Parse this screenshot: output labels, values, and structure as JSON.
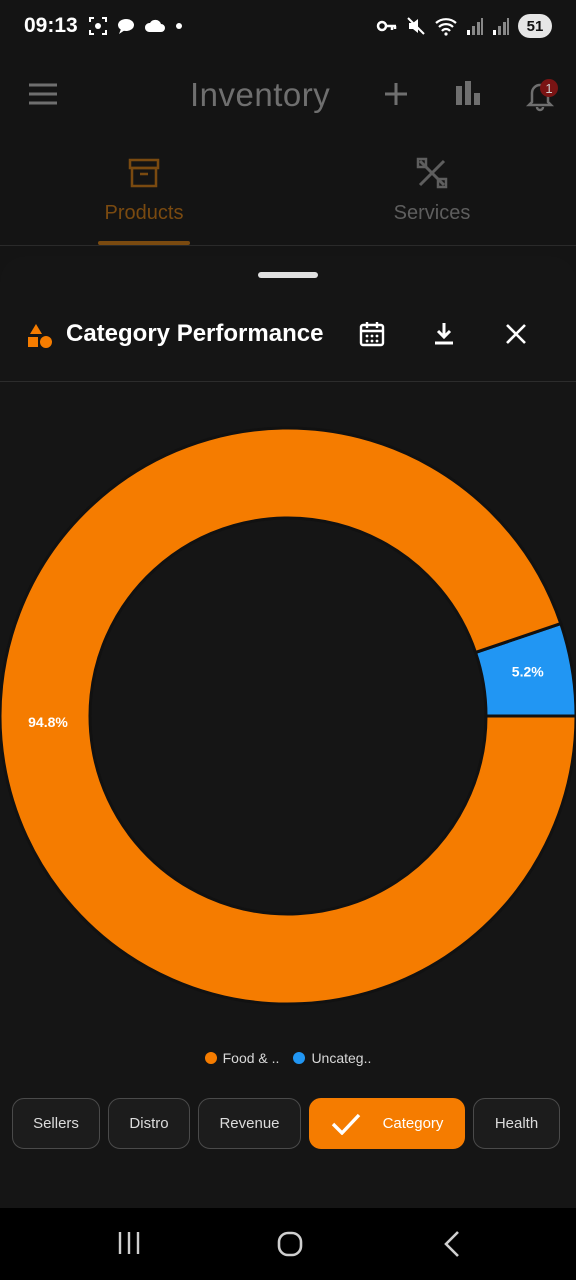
{
  "status_bar": {
    "time": "09:13",
    "battery": "51",
    "left_icons": [
      "screenshot-icon",
      "chat-bubble-icon",
      "cloud-icon",
      "dot-icon"
    ],
    "right_icons": [
      "key-icon",
      "mute-icon",
      "wifi-icon",
      "signal-icon",
      "signal-icon"
    ]
  },
  "app_bar": {
    "title": "Inventory",
    "notification_count": "1",
    "icons": [
      "menu-icon",
      "add-icon",
      "bar-chart-icon",
      "bell-icon"
    ]
  },
  "tabs": [
    {
      "label": "Products",
      "icon": "archive-box-icon",
      "active": true
    },
    {
      "label": "Services",
      "icon": "tools-icon",
      "active": false
    }
  ],
  "sheet": {
    "title": "Category Performance",
    "icons": [
      "category-shapes-icon",
      "calendar-icon",
      "download-icon",
      "close-icon"
    ]
  },
  "chart_data": {
    "type": "pie",
    "variant": "donut",
    "slices": [
      {
        "label": "Food & ..",
        "value": 94.8,
        "display": "94.8%",
        "color": "#f57c00"
      },
      {
        "label": "Uncateg..",
        "value": 5.2,
        "display": "5.2%",
        "color": "#2196f3"
      }
    ],
    "legend_position": "bottom"
  },
  "filters": [
    {
      "label": "Sellers",
      "selected": false
    },
    {
      "label": "Distro",
      "selected": false
    },
    {
      "label": "Revenue",
      "selected": false
    },
    {
      "label": "Category",
      "selected": true
    },
    {
      "label": "Health",
      "selected": false
    }
  ],
  "nav_bar": {
    "icons": [
      "recent-apps-icon",
      "home-icon",
      "back-icon"
    ]
  },
  "colors": {
    "accent": "#f57c00",
    "secondary": "#2196f3",
    "background": "#141414",
    "badge": "#c62828"
  }
}
